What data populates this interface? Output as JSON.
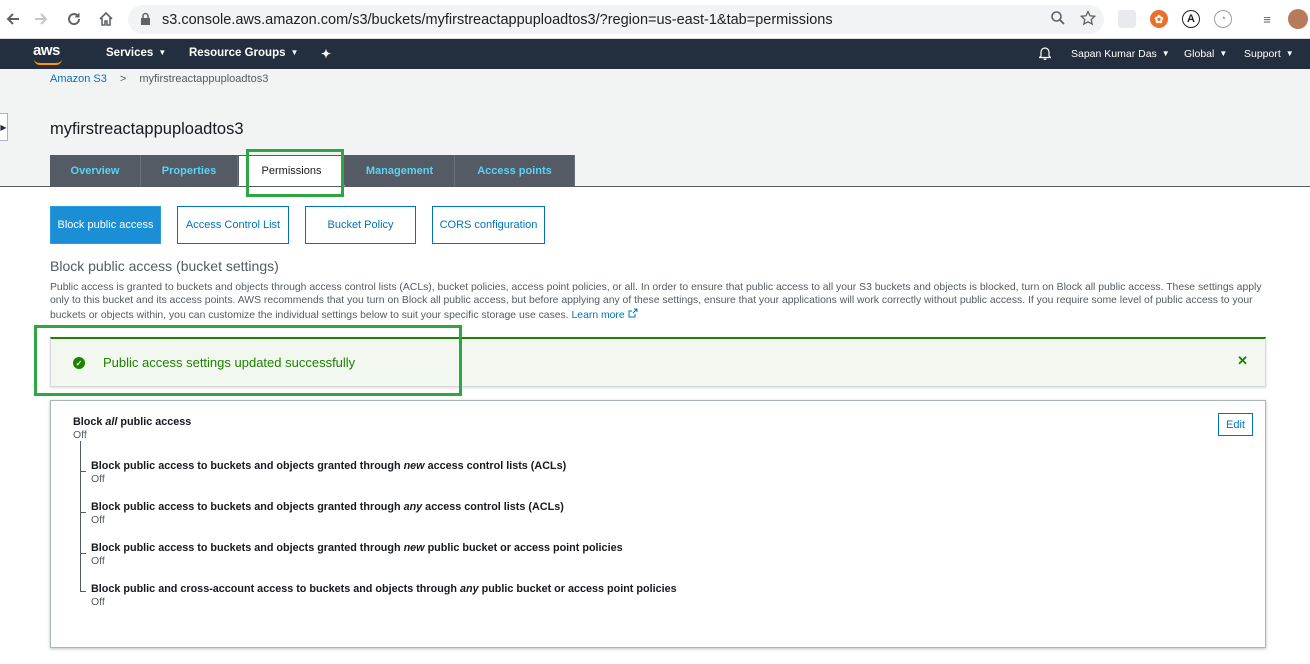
{
  "browser": {
    "url": "s3.console.aws.amazon.com/s3/buckets/myfirstreactappuploadtos3/?region=us-east-1&tab=permissions"
  },
  "navbar": {
    "logo": "aws",
    "services": "Services",
    "resource_groups": "Resource Groups",
    "user": "Sapan Kumar Das",
    "region": "Global",
    "support": "Support"
  },
  "breadcrumb": {
    "root": "Amazon S3",
    "current": "myfirstreactappuploadtos3"
  },
  "bucket_name": "myfirstreactappuploadtos3",
  "tabs": [
    {
      "label": "Overview"
    },
    {
      "label": "Properties"
    },
    {
      "label": "Permissions"
    },
    {
      "label": "Management"
    },
    {
      "label": "Access points"
    }
  ],
  "subtabs": [
    {
      "label": "Block public access"
    },
    {
      "label": "Access Control List"
    },
    {
      "label": "Bucket Policy"
    },
    {
      "label": "CORS configuration"
    }
  ],
  "section_title": "Block public access (bucket settings)",
  "description": "Public access is granted to buckets and objects through access control lists (ACLs), bucket policies, access point policies, or all. In order to ensure that public access to all your S3 buckets and objects is blocked, turn on Block all public access. These settings apply only to this bucket and its access points. AWS recommends that you turn on Block all public access, but before applying any of these settings, ensure that your applications will work correctly without public access. If you require some level of public access to your buckets or objects within, you can customize the individual settings below to suit your specific storage use cases.",
  "learn_more": "Learn more",
  "alert": {
    "message": "Public access settings updated successfully",
    "status_color": "#1d8102"
  },
  "panel": {
    "edit_label": "Edit",
    "main": {
      "pre": "Block ",
      "em": "all",
      "post": " public access",
      "value": "Off"
    },
    "settings": [
      {
        "pre": "Block public access to buckets and objects granted through ",
        "em": "new",
        "post": " access control lists (ACLs)",
        "value": "Off"
      },
      {
        "pre": "Block public access to buckets and objects granted through ",
        "em": "any",
        "post": " access control lists (ACLs)",
        "value": "Off"
      },
      {
        "pre": "Block public access to buckets and objects granted through ",
        "em": "new",
        "post": " public bucket or access point policies",
        "value": "Off"
      },
      {
        "pre": "Block public and cross-account access to buckets and objects through ",
        "em": "any",
        "post": " public bucket or access point policies",
        "value": "Off"
      }
    ]
  },
  "colors": {
    "aws_nav": "#232f3e",
    "aws_orange": "#ff9900",
    "highlight_green": "#2ea643",
    "link_blue": "#0073bb"
  }
}
